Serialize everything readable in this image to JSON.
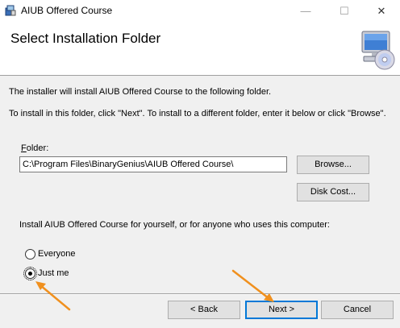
{
  "window": {
    "title": "AIUB Offered Course",
    "minimize_glyph": "—",
    "maximize_glyph": "☐",
    "close_glyph": "✕"
  },
  "banner": {
    "title": "Select Installation Folder",
    "icon": "computer-cd-icon"
  },
  "body": {
    "line1": "The installer will install AIUB Offered Course to the following folder.",
    "line2": "To install in this folder, click \"Next\". To install to a different folder, enter it below or click \"Browse\"."
  },
  "folder": {
    "label_prefix": "F",
    "label_rest": "older:",
    "value": "C:\\Program Files\\BinaryGenius\\AIUB Offered Course\\"
  },
  "buttons": {
    "browse": "Browse...",
    "disk_cost": "Disk Cost...",
    "back": "< Back",
    "next": "Next >",
    "cancel": "Cancel"
  },
  "install_for": {
    "prompt": "Install AIUB Offered Course for yourself, or for anyone who uses this computer:",
    "options": [
      {
        "label": "Everyone",
        "selected": false
      },
      {
        "label": "Just me",
        "selected": true
      }
    ]
  },
  "annotation_color": "#f0901e"
}
